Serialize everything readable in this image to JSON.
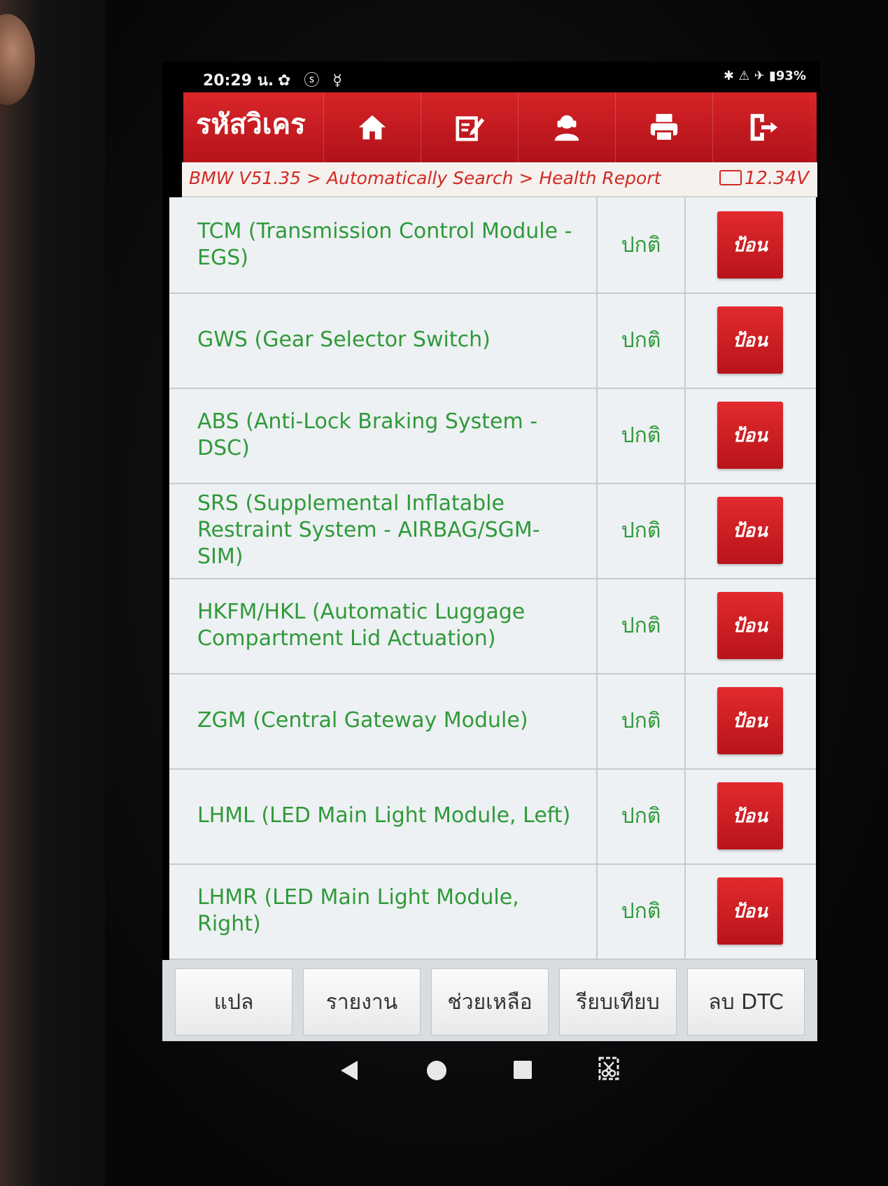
{
  "status_bar": {
    "time": "20:29 น.",
    "left_icons": "✿ ⓢ ☿",
    "right_status": "✱ ⚠ ✈ ▮93%"
  },
  "header": {
    "title": "รหัสวิเคร",
    "nav_icons": [
      "home-icon",
      "edit-icon",
      "user-icon",
      "printer-icon",
      "exit-icon"
    ]
  },
  "breadcrumb": {
    "path": "BMW V51.35 > Automatically Search > Health Report",
    "voltage": "12.34V"
  },
  "modules": [
    {
      "name": "TCM (Transmission Control Module - EGS)",
      "status": "ปกติ",
      "action": "ป้อน"
    },
    {
      "name": "GWS (Gear Selector Switch)",
      "status": "ปกติ",
      "action": "ป้อน"
    },
    {
      "name": "ABS (Anti-Lock Braking System - DSC)",
      "status": "ปกติ",
      "action": "ป้อน"
    },
    {
      "name": "SRS (Supplemental Inflatable Restraint System - AIRBAG/SGM-SIM)",
      "status": "ปกติ",
      "action": "ป้อน"
    },
    {
      "name": "HKFM/HKL (Automatic Luggage Compartment Lid Actuation)",
      "status": "ปกติ",
      "action": "ป้อน"
    },
    {
      "name": "ZGM (Central Gateway Module)",
      "status": "ปกติ",
      "action": "ป้อน"
    },
    {
      "name": "LHML (LED Main Light Module, Left)",
      "status": "ปกติ",
      "action": "ป้อน"
    },
    {
      "name": "LHMR (LED Main Light Module, Right)",
      "status": "ปกติ",
      "action": "ป้อน"
    }
  ],
  "toolbar": {
    "translate": "แปล",
    "report": "รายงาน",
    "help": "ช่วยเหลือ",
    "compare": "รียบเทียบ",
    "clear_dtc": "ลบ DTC"
  },
  "colors": {
    "brand_red": "#c91d22",
    "status_green": "#2f9a3a",
    "breadcrumb_red": "#d12a24"
  }
}
